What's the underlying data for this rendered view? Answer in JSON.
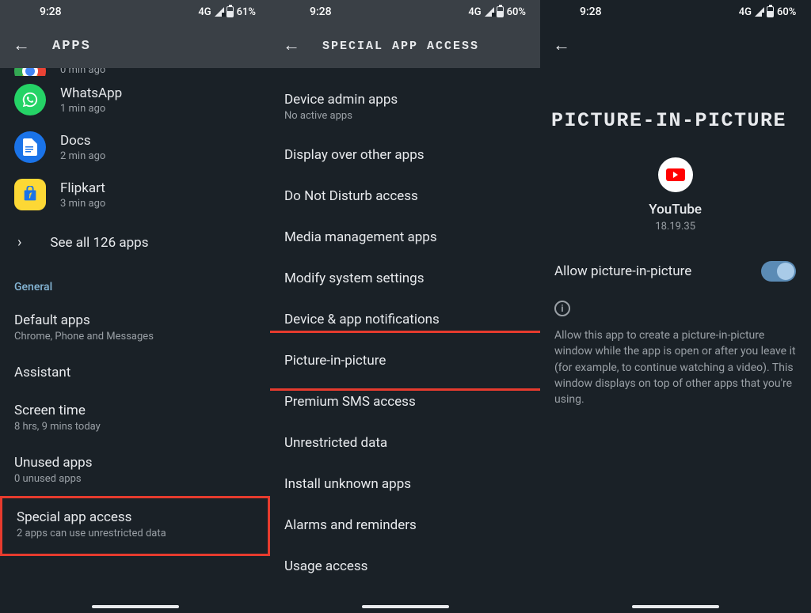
{
  "status": {
    "time": "9:28",
    "net": "4G",
    "battery1": "61%",
    "battery2": "60%",
    "battery3": "60%"
  },
  "panel1": {
    "title": "APPS",
    "partial_app_sub": "0 min ago",
    "apps": [
      {
        "name": "WhatsApp",
        "sub": "1 min ago"
      },
      {
        "name": "Docs",
        "sub": "2 min ago"
      },
      {
        "name": "Flipkart",
        "sub": "3 min ago"
      }
    ],
    "see_all": "See all 126 apps",
    "section": "General",
    "settings": [
      {
        "title": "Default apps",
        "sub": "Chrome, Phone and Messages"
      },
      {
        "title": "Assistant",
        "sub": ""
      },
      {
        "title": "Screen time",
        "sub": "8 hrs, 9 mins today"
      },
      {
        "title": "Unused apps",
        "sub": "0 unused apps"
      },
      {
        "title": "Special app access",
        "sub": "2 apps can use unrestricted data"
      }
    ]
  },
  "panel2": {
    "title": "SPECIAL APP ACCESS",
    "items": [
      {
        "title": "Device admin apps",
        "sub": "No active apps"
      },
      {
        "title": "Display over other apps",
        "sub": ""
      },
      {
        "title": "Do Not Disturb access",
        "sub": ""
      },
      {
        "title": "Media management apps",
        "sub": ""
      },
      {
        "title": "Modify system settings",
        "sub": ""
      },
      {
        "title": "Device & app notifications",
        "sub": ""
      },
      {
        "title": "Picture-in-picture",
        "sub": ""
      },
      {
        "title": "Premium SMS access",
        "sub": ""
      },
      {
        "title": "Unrestricted data",
        "sub": ""
      },
      {
        "title": "Install unknown apps",
        "sub": ""
      },
      {
        "title": "Alarms and reminders",
        "sub": ""
      },
      {
        "title": "Usage access",
        "sub": ""
      }
    ]
  },
  "panel3": {
    "title": "PICTURE-IN-PICTURE",
    "app_name": "YouTube",
    "app_version": "18.19.35",
    "toggle_label": "Allow picture-in-picture",
    "info": "Allow this app to create a picture-in-picture window while the app is open or after you leave it (for example, to continue watching a video). This window displays on top of other apps that you're using."
  }
}
